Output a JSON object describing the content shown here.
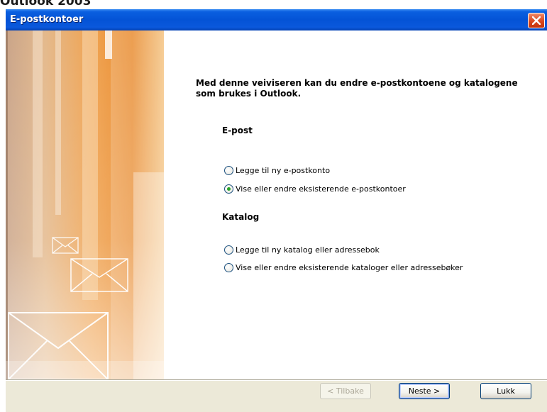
{
  "screenshot_caption": "Outlook 2003",
  "window": {
    "title": "E-postkontoer"
  },
  "wizard": {
    "intro": "Med denne veiviseren kan du endre e-postkontoene og katalogene som brukes i Outlook.",
    "sections": [
      {
        "heading": "E-post",
        "options": [
          {
            "label": "Legge til ny e-postkonto",
            "selected": false
          },
          {
            "label": "Vise eller endre eksisterende e-postkontoer",
            "selected": true
          }
        ]
      },
      {
        "heading": "Katalog",
        "options": [
          {
            "label": "Legge til ny katalog eller adressebok",
            "selected": false
          },
          {
            "label": "Vise eller endre eksisterende kataloger eller adressebøker",
            "selected": false
          }
        ]
      }
    ]
  },
  "buttons": {
    "back": {
      "label": "< Tilbake",
      "enabled": false
    },
    "next": {
      "label": "Neste >",
      "enabled": true
    },
    "close": {
      "label": "Lukk",
      "enabled": true
    }
  },
  "icons": {
    "close": "close-icon",
    "radio_checked_color": "#27a327"
  },
  "colors": {
    "titlebar": "#0453d6",
    "dialog_background": "#ece9d8",
    "banner_accent": "#e8892b"
  }
}
